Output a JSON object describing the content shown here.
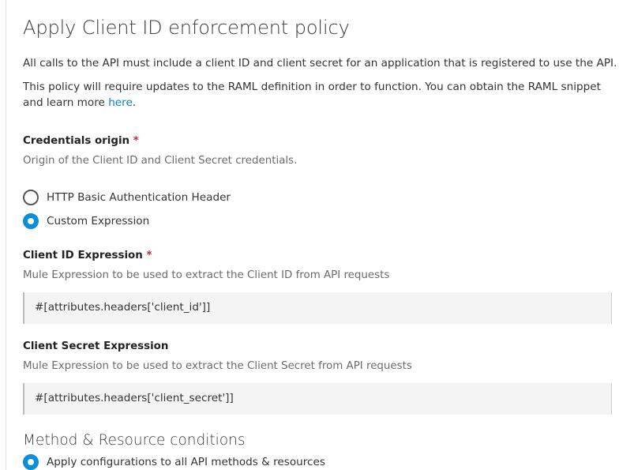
{
  "page": {
    "title": "Apply Client ID enforcement policy",
    "intro": "All calls to the API must include a client ID and client secret for an application that is registered to use the API.",
    "raml_note": "This policy will require updates to the RAML definition in order to function. You can obtain the RAML snippet and learn more ",
    "raml_link": "here",
    "raml_period": "."
  },
  "credentials_origin": {
    "label": "Credentials origin",
    "required_mark": "*",
    "help": "Origin of the Client ID and Client Secret credentials.",
    "options": [
      {
        "label": "HTTP Basic Authentication Header",
        "checked": false
      },
      {
        "label": "Custom Expression",
        "checked": true
      }
    ]
  },
  "client_id_expression": {
    "label": "Client ID Expression",
    "required_mark": "*",
    "help": "Mule Expression to be used to extract the Client ID from API requests",
    "value": "#[attributes.headers['client_id']]"
  },
  "client_secret_expression": {
    "label": "Client Secret Expression",
    "help": "Mule Expression to be used to extract the Client Secret from API requests",
    "value": "#[attributes.headers['client_secret']]"
  },
  "method_resource": {
    "title": "Method & Resource conditions",
    "options": [
      {
        "label": "Apply configurations to all API methods & resources",
        "checked": true
      }
    ]
  },
  "colors": {
    "accent": "#0b8fd9",
    "link": "#0b7fbf",
    "required": "#c8252c"
  }
}
